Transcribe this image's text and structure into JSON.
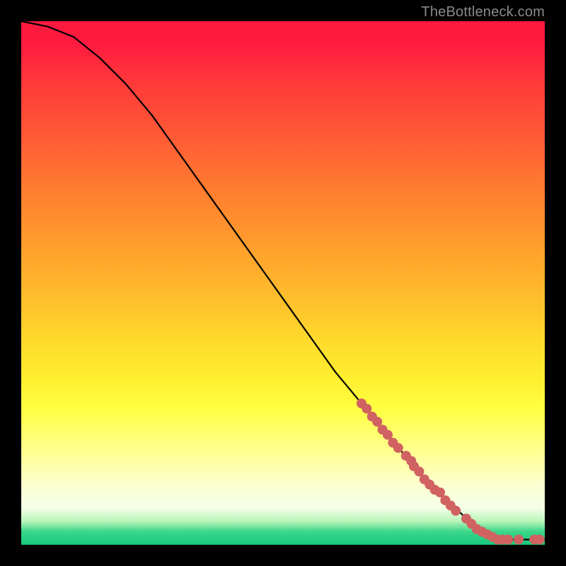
{
  "watermark": "TheBottleneck.com",
  "chart_data": {
    "type": "line",
    "title": "",
    "xlabel": "",
    "ylabel": "",
    "xlim": [
      0,
      100
    ],
    "ylim": [
      0,
      100
    ],
    "curve": {
      "name": "bottleneck-curve",
      "x": [
        0,
        5,
        10,
        15,
        20,
        25,
        30,
        35,
        40,
        45,
        50,
        55,
        60,
        65,
        70,
        75,
        80,
        85,
        88,
        90,
        92,
        95,
        100
      ],
      "y": [
        100,
        99,
        97,
        93,
        88,
        82,
        75,
        68,
        61,
        54,
        47,
        40,
        33,
        27,
        21,
        15,
        10,
        5,
        3,
        1.5,
        1,
        1,
        1
      ]
    },
    "markers": {
      "name": "sample-points",
      "color": "#d06262",
      "radius_px": 7,
      "points": [
        {
          "x": 65,
          "y": 27
        },
        {
          "x": 66,
          "y": 26
        },
        {
          "x": 67,
          "y": 24.5
        },
        {
          "x": 68,
          "y": 23.5
        },
        {
          "x": 69,
          "y": 22
        },
        {
          "x": 70,
          "y": 21
        },
        {
          "x": 71,
          "y": 19.5
        },
        {
          "x": 72,
          "y": 18.5
        },
        {
          "x": 73.5,
          "y": 17
        },
        {
          "x": 74.5,
          "y": 16
        },
        {
          "x": 75,
          "y": 15
        },
        {
          "x": 76,
          "y": 14
        },
        {
          "x": 77,
          "y": 12.5
        },
        {
          "x": 78,
          "y": 11.5
        },
        {
          "x": 79,
          "y": 10.5
        },
        {
          "x": 80,
          "y": 10
        },
        {
          "x": 81,
          "y": 8.5
        },
        {
          "x": 82,
          "y": 7.5
        },
        {
          "x": 83,
          "y": 6.5
        },
        {
          "x": 85,
          "y": 5
        },
        {
          "x": 86,
          "y": 4
        },
        {
          "x": 87,
          "y": 3
        },
        {
          "x": 88,
          "y": 2.5
        },
        {
          "x": 89,
          "y": 2
        },
        {
          "x": 90,
          "y": 1.5
        },
        {
          "x": 91,
          "y": 1
        },
        {
          "x": 92,
          "y": 1
        },
        {
          "x": 93,
          "y": 1
        },
        {
          "x": 95,
          "y": 1
        },
        {
          "x": 98,
          "y": 1
        },
        {
          "x": 99,
          "y": 1
        }
      ]
    }
  }
}
